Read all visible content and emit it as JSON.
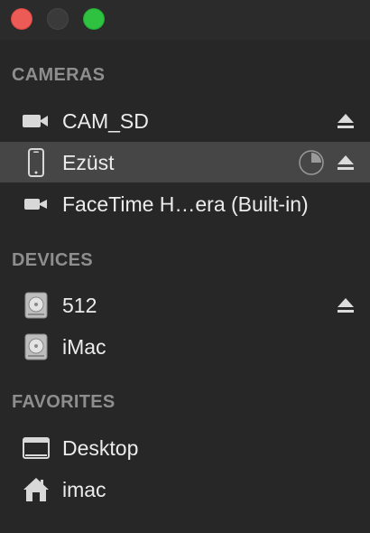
{
  "window": {
    "controls": [
      "close",
      "minimize",
      "zoom"
    ]
  },
  "sections": {
    "cameras": {
      "header": "CAMERAS",
      "items": [
        {
          "label": "CAM_SD",
          "icon": "video-camera-icon",
          "ejectable": true
        },
        {
          "label": "Ezüst",
          "icon": "iphone-icon",
          "ejectable": true,
          "selected": true,
          "progress": 0.25
        },
        {
          "label": "FaceTime H…era (Built-in)",
          "icon": "video-camera-icon",
          "ejectable": false
        }
      ]
    },
    "devices": {
      "header": "DEVICES",
      "items": [
        {
          "label": "512",
          "icon": "hard-drive-icon",
          "ejectable": true
        },
        {
          "label": "iMac",
          "icon": "hard-drive-icon",
          "ejectable": false
        }
      ]
    },
    "favorites": {
      "header": "FAVORITES",
      "items": [
        {
          "label": "Desktop",
          "icon": "desktop-folder-icon"
        },
        {
          "label": "imac",
          "icon": "home-icon"
        }
      ]
    }
  },
  "colors": {
    "background": "#272727",
    "selection": "#464646",
    "section_header": "#8e8e8e",
    "text": "#ececec",
    "close": "#ed5b57",
    "zoom": "#2fc240"
  }
}
